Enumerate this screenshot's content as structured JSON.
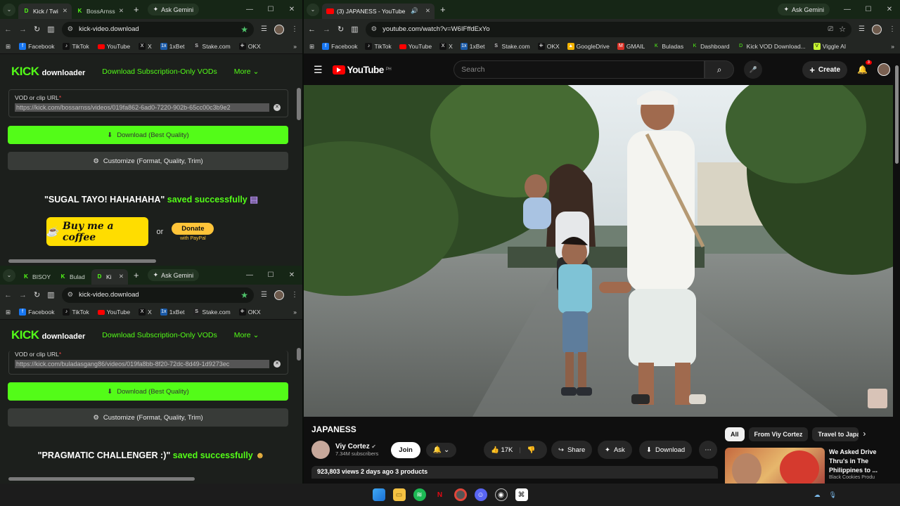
{
  "colors": {
    "kick_green": "#53fc18",
    "yt_red": "#ff0000",
    "coffee_yellow": "#ffdd00"
  },
  "top_left": {
    "tabs": [
      {
        "label": "Kick / Twi"
      },
      {
        "label": "BossArnss"
      }
    ],
    "gemini": "Ask Gemini",
    "url": "kick-video.download",
    "bookmarks": [
      "Facebook",
      "TikTok",
      "YouTube",
      "X",
      "1xBet",
      "Stake.com",
      "OKX"
    ],
    "nav": {
      "subscription": "Download Subscription-Only VODs",
      "more": "More"
    },
    "form": {
      "label": "VOD or clip URL",
      "value": "https://kick.com/bossarnss/videos/019fa862-6ad0-7220-902b-65cc00c3b9e2"
    },
    "download_btn": "Download (Best Quality)",
    "customize_btn": "Customize (Format, Quality, Trim)",
    "saved_title": "\"SUGAL TAYO! HAHAHAHA\"",
    "saved_suffix": "saved successfully",
    "coffee": "Buy me a coffee",
    "or": "or",
    "donate": "Donate",
    "paypal": "with PayPal"
  },
  "bottom_left": {
    "tabs": [
      {
        "label": "BISOY"
      },
      {
        "label": "Bulad"
      },
      {
        "label": "Ki"
      }
    ],
    "gemini": "Ask Gemini",
    "url": "kick-video.download",
    "bookmarks": [
      "Facebook",
      "TikTok",
      "YouTube",
      "X",
      "1xBet",
      "Stake.com",
      "OKX"
    ],
    "nav": {
      "subscription": "Download Subscription-Only VODs",
      "more": "More"
    },
    "form": {
      "label": "VOD or clip URL",
      "value": "https://kick.com/buladasgang86/videos/019fa8bb-8f20-72dc-8d49-1d9273ec"
    },
    "download_btn": "Download (Best Quality)",
    "customize_btn": "Customize (Format, Quality, Trim)",
    "saved_title": "\"PRAGMATIC CHALLENGER :)\"",
    "saved_suffix": "saved successfully"
  },
  "youtube_window": {
    "tab": "(3) JAPANESS - YouTube",
    "gemini": "Ask Gemini",
    "url": "youtube.com/watch?v=W6IFffdExYo",
    "bookmarks": [
      "Facebook",
      "TikTok",
      "YouTube",
      "X",
      "1xBet",
      "Stake.com",
      "OKX",
      "GoogleDrive",
      "GMAIL",
      "Buladas",
      "Dashboard",
      "Kick VOD Download...",
      "Viggle AI"
    ],
    "region": "PH",
    "search_placeholder": "Search",
    "create": "Create",
    "notifications": "3",
    "video_title": "JAPANESS",
    "channel": "Viy Cortez",
    "subscribers": "7.34M subscribers",
    "join": "Join",
    "likes": "17K",
    "share": "Share",
    "ask": "Ask",
    "download": "Download",
    "stats": "923,803 views  2 days ago  3 products",
    "chips": [
      "All",
      "From Viy Cortez",
      "Travel to Japan"
    ],
    "recommended": {
      "title": "We Asked Drive Thru's in The Philippines to ...",
      "channel": "Black Cookies Produ"
    }
  },
  "taskbar": {
    "icons": [
      "windows-start",
      "file-explorer",
      "spotify",
      "netflix",
      "chrome",
      "discord",
      "obs",
      "capcut"
    ]
  }
}
